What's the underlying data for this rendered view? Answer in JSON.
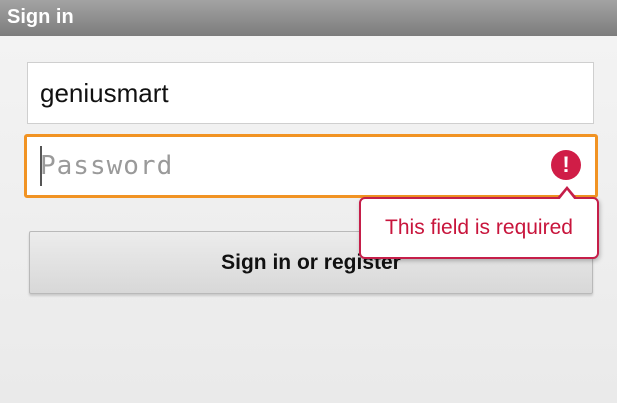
{
  "window": {
    "title": "Sign in"
  },
  "form": {
    "username_value": "geniusmart",
    "password_value": "",
    "password_placeholder": "Password",
    "submit_label": "Sign in or register"
  },
  "error": {
    "icon": "error-exclamation-icon",
    "icon_glyph": "!",
    "message": "This field is required"
  },
  "colors": {
    "focus_border": "#f19323",
    "error": "#d01d47"
  }
}
